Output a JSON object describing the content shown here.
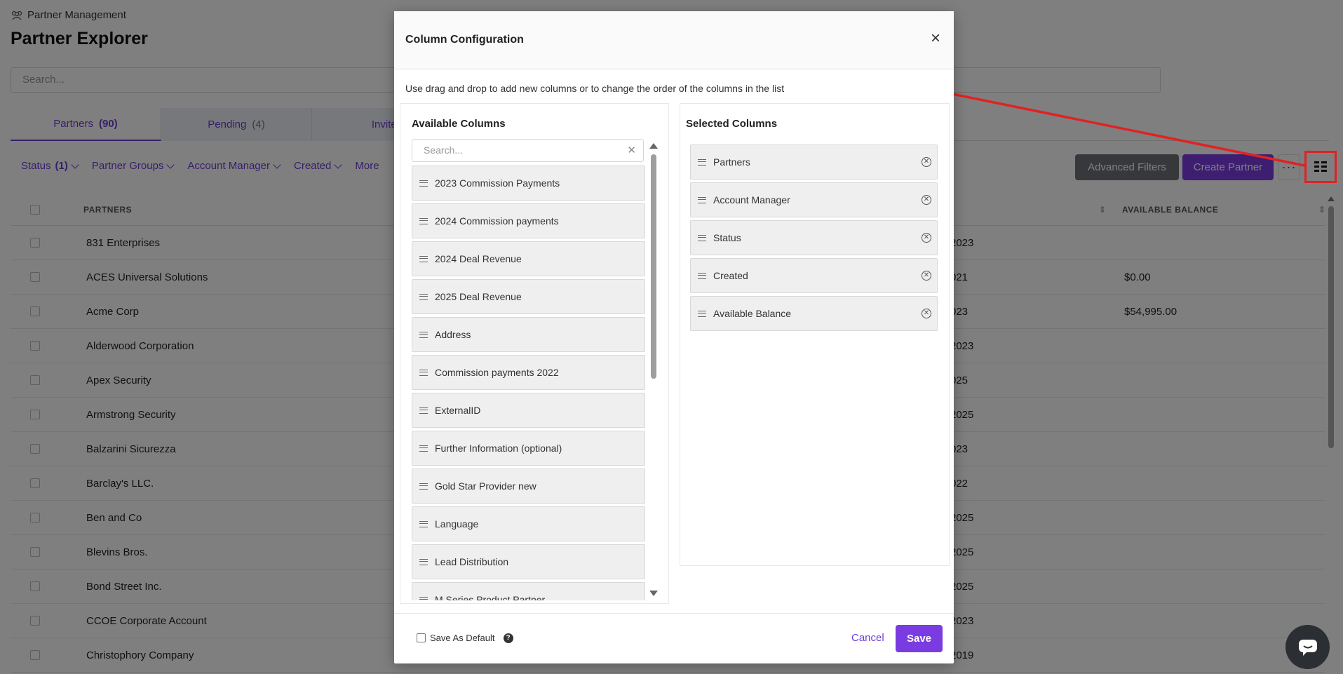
{
  "breadcrumb": {
    "label": "Partner Management"
  },
  "page": {
    "title": "Partner Explorer",
    "search_placeholder": "Search..."
  },
  "tabs": [
    {
      "label": "Partners",
      "count": "(90)"
    },
    {
      "label": "Pending",
      "count": "(4)"
    },
    {
      "label": "Invited",
      "count": ""
    }
  ],
  "filters": [
    {
      "label": "Status",
      "count": "(1)"
    },
    {
      "label": "Partner Groups",
      "count": ""
    },
    {
      "label": "Account Manager",
      "count": ""
    },
    {
      "label": "Created",
      "count": ""
    },
    {
      "label": "More",
      "count": ""
    }
  ],
  "toolbar": {
    "advanced_filters_label": "Advanced Filters",
    "create_partner_label": "Create Partner",
    "more_label": "···",
    "columns_icon": "columns-icon"
  },
  "table": {
    "headers": {
      "partners": "PARTNERS",
      "available_balance": "AVAILABLE BALANCE"
    },
    "rows": [
      {
        "name": "831 Enterprises",
        "date": "2023",
        "balance": ""
      },
      {
        "name": "ACES Universal Solutions",
        "date": "021",
        "balance": "$0.00"
      },
      {
        "name": "Acme Corp",
        "date": "023",
        "balance": "$54,995.00"
      },
      {
        "name": "Alderwood Corporation",
        "date": "2023",
        "balance": ""
      },
      {
        "name": "Apex Security",
        "date": "025",
        "balance": ""
      },
      {
        "name": "Armstrong Security",
        "date": "2025",
        "balance": ""
      },
      {
        "name": "Balzarini Sicurezza",
        "date": "023",
        "balance": ""
      },
      {
        "name": "Barclay's LLC.",
        "date": "022",
        "balance": ""
      },
      {
        "name": "Ben and Co",
        "date": "2025",
        "balance": ""
      },
      {
        "name": "Blevins Bros.",
        "date": "2025",
        "balance": ""
      },
      {
        "name": "Bond Street Inc.",
        "date": "2025",
        "balance": ""
      },
      {
        "name": "CCOE Corporate Account",
        "date": "2023",
        "balance": ""
      },
      {
        "name": "Christophory Company",
        "date": "2019",
        "balance": ""
      }
    ]
  },
  "modal": {
    "title": "Column Configuration",
    "close_label": "×",
    "instructions": "Use drag and drop to add new columns or to change the order of the columns in the list",
    "available": {
      "title": "Available Columns",
      "search_placeholder": "Search...",
      "clear_label": "✕",
      "items": [
        "2023 Commission Payments",
        "2024 Commission payments",
        "2024 Deal Revenue",
        "2025 Deal Revenue",
        "Address",
        "Commission payments 2022",
        "ExternalID",
        "Further Information (optional)",
        "Gold Star Provider new",
        "Language",
        "Lead Distribution",
        "M Series Product Partner"
      ]
    },
    "selected": {
      "title": "Selected Columns",
      "items": [
        "Partners",
        "Account Manager",
        "Status",
        "Created",
        "Available Balance"
      ]
    },
    "footer": {
      "save_default_label": "Save As Default",
      "help_label": "?",
      "cancel_label": "Cancel",
      "save_label": "Save"
    }
  },
  "colors": {
    "accent": "#7a3ce0",
    "annotation": "#e02222",
    "gray_button": "#6f7178"
  }
}
